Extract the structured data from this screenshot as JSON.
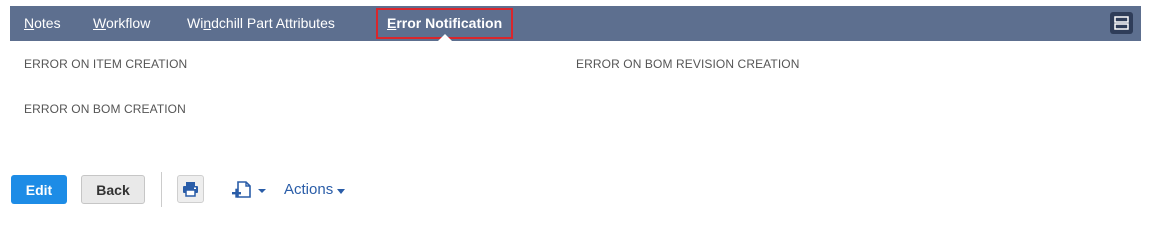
{
  "tabs": [
    {
      "label_first": "N",
      "label_rest": "otes"
    },
    {
      "label_first": "W",
      "label_rest": "orkflow"
    },
    {
      "label_first": "Wi",
      "label_mid": "n",
      "label_rest": "dchill Part Attributes"
    },
    {
      "label_first": "E",
      "label_rest": "rror Notification",
      "active": true
    }
  ],
  "fields": {
    "error_item_creation": "ERROR ON ITEM CREATION",
    "error_bom_revision_creation": "ERROR ON BOM REVISION CREATION",
    "error_bom_creation": "ERROR ON BOM CREATION"
  },
  "toolbar": {
    "edit_label": "Edit",
    "back_label": "Back",
    "actions_label": "Actions"
  },
  "icons": {
    "layout": "layout-toggle-icon",
    "print": "print-icon",
    "new_record": "new-record-icon",
    "dropdown": "caret-down-icon"
  },
  "colors": {
    "tabbar_bg": "#5d6f8f",
    "active_tab_highlight": "#d9262c",
    "edit_button": "#1d8ce6",
    "link": "#2a5da8"
  }
}
